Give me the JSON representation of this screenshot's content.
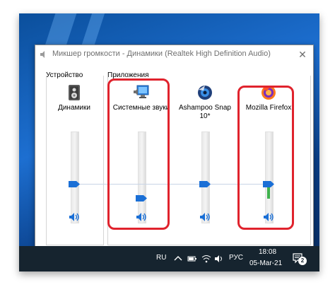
{
  "window": {
    "title": "Микшер громкости - Динамики (Realtek High Definition Audio)",
    "close_label": "✕"
  },
  "groups": {
    "device_label": "Устройство",
    "apps_label": "Приложения"
  },
  "channels": [
    {
      "key": "speakers",
      "name": "Динамики",
      "icon": "speaker-device-icon",
      "level": 0.45,
      "peak": 0
    },
    {
      "key": "system-sounds",
      "name": "Системные звуки",
      "icon": "system-sounds-icon",
      "level": 0.05,
      "peak": 0
    },
    {
      "key": "ashampoo",
      "name": "Ashampoo Snap 10*",
      "icon": "ashampoo-snap-icon",
      "level": 0.45,
      "peak": 0
    },
    {
      "key": "firefox",
      "name": "Mozilla Firefox",
      "icon": "firefox-icon",
      "level": 0.45,
      "peak": 0.12
    }
  ],
  "taskbar": {
    "lang_short": "RU",
    "lang_long": "РУС",
    "time": "18:08",
    "date": "05-Mar-21",
    "notifications_count": "2"
  },
  "colors": {
    "highlight": "#e0232d",
    "slider_thumb": "#1a6fd6",
    "peak_meter": "#3fb24d",
    "taskbar": "#16242f"
  }
}
